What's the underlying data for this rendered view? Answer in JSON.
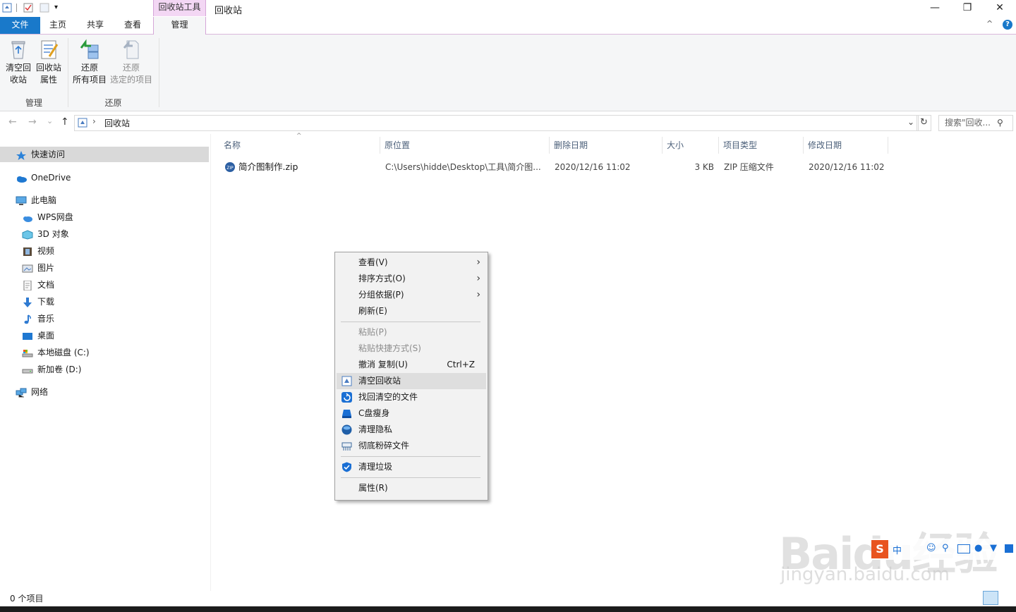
{
  "window": {
    "context_tab_group": "回收站工具",
    "title": "回收站",
    "minimize": "—",
    "restore": "❐",
    "close": "✕"
  },
  "ribbon_tabs": {
    "file": "文件",
    "home": "主页",
    "share": "共享",
    "view": "查看",
    "manage": "管理",
    "help": "?",
    "collapse": "^"
  },
  "ribbon": {
    "empty_bin_l1": "清空回",
    "empty_bin_l2": "收站",
    "bin_props_l1": "回收站",
    "bin_props_l2": "属性",
    "restore_all_l1": "还原",
    "restore_all_l2": "所有项目",
    "restore_sel_l1": "还原",
    "restore_sel_l2": "选定的项目",
    "group_manage": "管理",
    "group_restore": "还原"
  },
  "address": {
    "path": "回收站",
    "sep": "›",
    "search_placeholder": "搜索\"回收...",
    "back": "←",
    "forward": "→",
    "up": "↑",
    "recent": "⌄",
    "dropdown": "⌄",
    "refresh": "↻",
    "search_icon": "⚲"
  },
  "nav": {
    "quick_access": "快速访问",
    "onedrive": "OneDrive",
    "this_pc": "此电脑",
    "wps": "WPS网盘",
    "objects3d": "3D 对象",
    "videos": "视频",
    "pictures": "图片",
    "documents": "文档",
    "downloads": "下载",
    "music": "音乐",
    "desktop": "桌面",
    "local_c": "本地磁盘 (C:)",
    "new_d": "新加卷 (D:)",
    "network": "网络"
  },
  "columns": {
    "name": "名称",
    "orig_loc": "原位置",
    "deleted": "删除日期",
    "size": "大小",
    "type": "项目类型",
    "modified": "修改日期"
  },
  "files": [
    {
      "name": "简介图制作.zip",
      "orig_loc": "C:\\Users\\hidde\\Desktop\\工具\\简介图...",
      "deleted": "2020/12/16 11:02",
      "size": "3 KB",
      "type": "ZIP 压缩文件",
      "modified": "2020/12/16 11:02"
    }
  ],
  "context_menu": {
    "view": "查看(V)",
    "sort": "排序方式(O)",
    "group": "分组依据(P)",
    "refresh": "刷新(E)",
    "paste": "粘贴(P)",
    "paste_shortcut": "粘贴快捷方式(S)",
    "undo": "撤消 复制(U)",
    "undo_accel": "Ctrl+Z",
    "empty_bin": "清空回收站",
    "recover": "找回清空的文件",
    "c_slim": "C盘瘦身",
    "privacy": "清理隐私",
    "shred": "彻底粉碎文件",
    "junk": "清理垃圾",
    "properties": "属性(R)",
    "submenu_arrow": "›"
  },
  "status": {
    "count": "0 个项目"
  },
  "watermark": {
    "logo": "Baidu经验",
    "url": "jingyan.baidu.com"
  },
  "colors": {
    "accent": "#1979ca",
    "context_tab": "#f3d7f4",
    "menu_bg": "#f2f2f2",
    "menu_hover": "#dedede",
    "nav_selected": "#d9d9d9"
  }
}
